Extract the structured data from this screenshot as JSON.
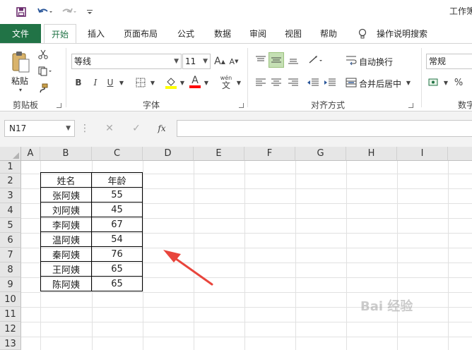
{
  "window": {
    "title": "工作簿"
  },
  "quick_access": {
    "save_icon": "save-icon",
    "undo_icon": "undo-icon",
    "redo_icon": "redo-icon",
    "customize_icon": "chevron-down-icon"
  },
  "tabs": [
    {
      "label": "文件"
    },
    {
      "label": "开始"
    },
    {
      "label": "插入"
    },
    {
      "label": "页面布局"
    },
    {
      "label": "公式"
    },
    {
      "label": "数据"
    },
    {
      "label": "审阅"
    },
    {
      "label": "视图"
    },
    {
      "label": "帮助"
    },
    {
      "label": "操作说明搜索"
    }
  ],
  "ribbon": {
    "clipboard": {
      "paste_label": "粘贴",
      "group_label": "剪贴板"
    },
    "font": {
      "font_name": "等线",
      "font_size": "11",
      "bold": "B",
      "italic": "I",
      "underline": "U",
      "grow": "A",
      "shrink": "A",
      "font_color": "A",
      "wen": "wén",
      "wen_char": "文",
      "group_label": "字体",
      "fill_color": "#ffff00",
      "text_color": "#ff0000"
    },
    "alignment": {
      "wrap_label": "自动换行",
      "merge_label": "合并后居中",
      "group_label": "对齐方式"
    },
    "number": {
      "format": "常规",
      "percent": "%",
      "group_label": "数字"
    }
  },
  "formula_bar": {
    "name_box": "N17",
    "cancel": "✕",
    "enter": "✓",
    "fx": "fx",
    "formula": ""
  },
  "columns": [
    "A",
    "B",
    "C",
    "D",
    "E",
    "F",
    "G",
    "H",
    "I"
  ],
  "rows": [
    "1",
    "2",
    "3",
    "4",
    "5",
    "6",
    "7",
    "8",
    "9",
    "10",
    "11",
    "12",
    "13"
  ],
  "table": {
    "headers": [
      "姓名",
      "年龄"
    ],
    "rows": [
      [
        "张阿姨",
        "55"
      ],
      [
        "刘阿姨",
        "45"
      ],
      [
        "李阿姨",
        "67"
      ],
      [
        "温阿姨",
        "54"
      ],
      [
        "秦阿姨",
        "76"
      ],
      [
        "王阿姨",
        "65"
      ],
      [
        "陈阿姨",
        "65"
      ]
    ]
  },
  "annotation": {
    "arrow_color": "#e8453c"
  },
  "watermark": "Bai 经验"
}
